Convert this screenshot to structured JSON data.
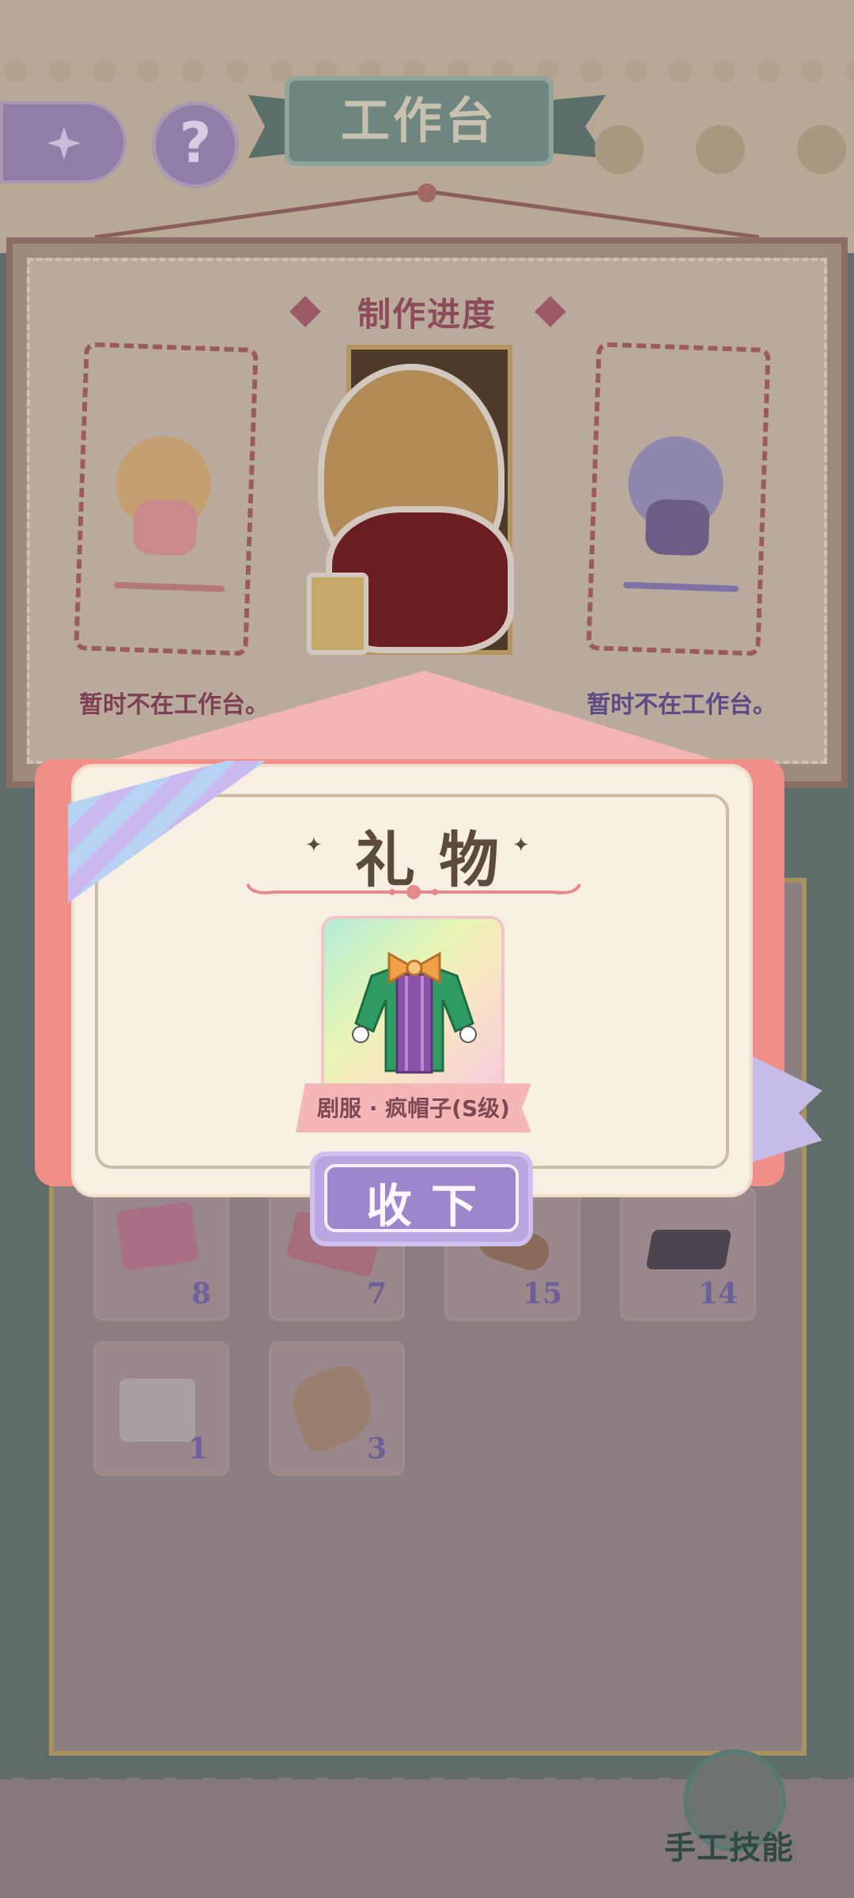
{
  "header": {
    "title": "工作台",
    "back_icon": "sparkle-back-icon",
    "help_label": "?"
  },
  "progress": {
    "title": "制作进度",
    "left_slot_status": "暂时不在工作台。",
    "right_slot_status": "暂时不在工作台。"
  },
  "gift_modal": {
    "title": "礼物",
    "item_name": "剧服 · 疯帽子(S级)",
    "accept_label": "收下"
  },
  "inventory": {
    "items": [
      {
        "name": "sewing-kit-icon",
        "count": "8"
      },
      {
        "name": "fabric-swatch-icon",
        "count": "7"
      },
      {
        "name": "wood-log-icon",
        "count": "15"
      },
      {
        "name": "metal-ingot-icon",
        "count": "14"
      },
      {
        "name": "paper-roll-icon",
        "count": "1"
      },
      {
        "name": "fur-pelt-icon",
        "count": "3"
      }
    ]
  },
  "footer": {
    "skill_label": "手工技能"
  },
  "colors": {
    "accept_button": "#9c86cc",
    "gift_card": "#f6efe2",
    "envelope": "#f08e88",
    "title_banner": "#6f857f",
    "slot_text": "#7e3e56"
  }
}
